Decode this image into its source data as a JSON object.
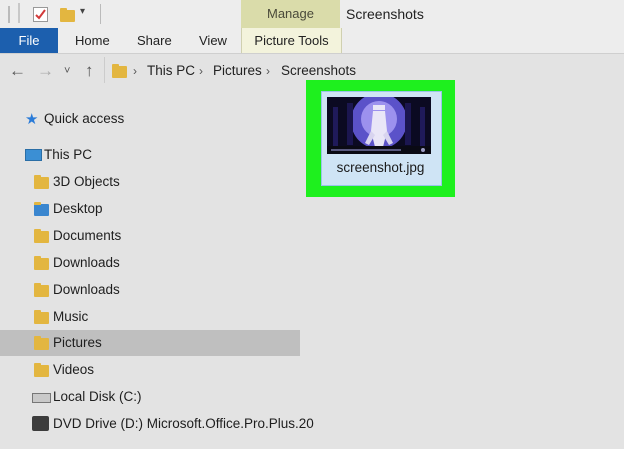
{
  "window": {
    "title": "Screenshots"
  },
  "ribbon": {
    "manage_label": "Manage",
    "tabs": [
      "File",
      "Home",
      "Share",
      "View",
      "Picture Tools"
    ]
  },
  "address": {
    "path": [
      "This PC",
      "Pictures",
      "Screenshots"
    ]
  },
  "nav": {
    "quick_access": "Quick access",
    "this_pc": "This PC",
    "items": [
      "3D Objects",
      "Desktop",
      "Documents",
      "Downloads",
      "Downloads",
      "Music",
      "Pictures",
      "Videos",
      "Local Disk (C:)",
      "DVD Drive (D:) Microsoft.Office.Pro.Plus.20"
    ]
  },
  "file": {
    "name": "screenshot.jpg"
  },
  "colors": {
    "file_tab": "#1c5fae",
    "selection_highlight": "#1ef01e",
    "manage_tab": "#dadcaa"
  },
  "icons": [
    "folder-icon",
    "checklist-icon",
    "dropdown-icon",
    "back-arrow-icon",
    "forward-arrow-icon",
    "up-arrow-icon",
    "star-icon",
    "computer-icon",
    "drive-icon",
    "dvd-icon"
  ]
}
